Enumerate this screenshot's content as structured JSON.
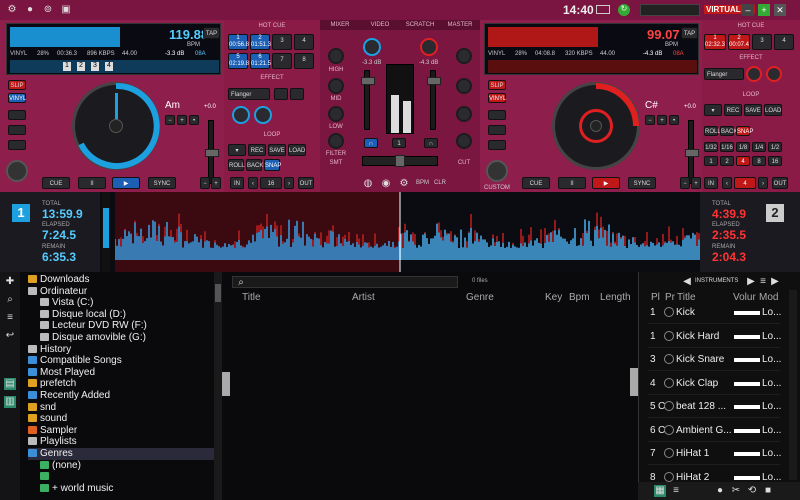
{
  "titlebar": {
    "time": "14:40",
    "battery_label": "",
    "brand": "VIRTUAL DJ"
  },
  "deck_left": {
    "bpm": "119.88",
    "bpm_unit": "BPM",
    "tap": "TAP",
    "pitch": "-3.3 dB",
    "key_display": "08A",
    "key": "Am",
    "pitch_val": "+0.0",
    "format": "VINYL",
    "pct": "28%",
    "time_a": "00:36.3",
    "bitrate": "896 KBPS",
    "sr": "44.00",
    "loop_val": "16",
    "flanger": "Flanger",
    "hotcue_nums": [
      "1",
      "2",
      "3",
      "4"
    ],
    "hotcue_times": [
      "00:56.8",
      "01:51.3",
      "",
      ""
    ],
    "hotcue_nums2": [
      "5",
      "6",
      "7",
      "8"
    ],
    "hotcue_times2": [
      "02:19.8",
      "01:21.5",
      "",
      ""
    ],
    "markers": [
      "1",
      "2",
      "3",
      "4"
    ]
  },
  "deck_right": {
    "bpm": "99.07",
    "bpm_unit": "BPM",
    "tap": "TAP",
    "pitch": "-4.3 dB",
    "key_display": "08A",
    "key": "C#",
    "pitch_val": "+0.0",
    "format": "VINYL",
    "pct": "28%",
    "time_a": "04:08.8",
    "bitrate": "320 KBPS",
    "sr": "44.00",
    "loop_val": "4",
    "flanger": "Flanger",
    "hotcue_nums": [
      "1",
      "2",
      "3",
      "4"
    ],
    "hotcue_times": [
      "02:32.3",
      "00:07.4",
      "",
      ""
    ]
  },
  "mixer": {
    "tabs": [
      "MIXER",
      "VIDEO",
      "SCRATCH",
      "MASTER"
    ],
    "labels": [
      "HIGH",
      "MID",
      "LOW",
      "FILTER",
      "GAIN",
      "GAIN",
      "SMT",
      "CUT"
    ],
    "gain_l": "-3.3 dB",
    "gain_r": "-4.3 dB",
    "cross_val": "1"
  },
  "deck_labels": {
    "hotcue": "HOT CUE",
    "effect": "EFFECT",
    "loop": "LOOP",
    "sync": "SYNC",
    "cue": "CUE",
    "play": "▶",
    "pause": "II",
    "slip": "SLIP",
    "vinyl": "VINYL",
    "custom": "CUSTOM",
    "in": "IN",
    "out": "OUT",
    "rec": "REC",
    "save": "SAVE",
    "load": "LOAD",
    "roll": "ROLL",
    "back": "BACK",
    "snap": "SNAP",
    "size_small": "1/32",
    "size_labels": [
      "1/16",
      "1/8",
      "1/4",
      "1/2",
      "1",
      "2",
      "4",
      "8",
      "16",
      "32"
    ]
  },
  "wave_left": {
    "deck": "1",
    "total_label": "TOTAL",
    "total": "13:59.9",
    "elapsed_label": "ELAPSED",
    "elapsed": "7:24.5",
    "remain_label": "REMAIN",
    "remain": "6:35.3"
  },
  "wave_right": {
    "deck": "2",
    "total_label": "TOTAL",
    "total": "4:39.9",
    "elapsed_label": "ELAPSED",
    "elapsed": "2:35.5",
    "remain_label": "REMAIN",
    "remain": "2:04.3"
  },
  "browser": {
    "tree": [
      {
        "label": "Downloads",
        "indent": 0,
        "color": "#e0a020"
      },
      {
        "label": "Ordinateur",
        "indent": 0,
        "color": "#bbbbbb"
      },
      {
        "label": "Vista (C:)",
        "indent": 1,
        "color": "#bbbbbb"
      },
      {
        "label": "Disque local (D:)",
        "indent": 1,
        "color": "#bbbbbb"
      },
      {
        "label": "Lecteur DVD RW (F:)",
        "indent": 1,
        "color": "#bbbbbb"
      },
      {
        "label": "Disque amovible (G:)",
        "indent": 1,
        "color": "#bbbbbb"
      },
      {
        "label": "History",
        "indent": 0,
        "color": "#bbbbbb"
      },
      {
        "label": "Compatible Songs",
        "indent": 0,
        "color": "#3a8fd8"
      },
      {
        "label": "Most Played",
        "indent": 0,
        "color": "#3a8fd8"
      },
      {
        "label": "prefetch",
        "indent": 0,
        "color": "#e0a020"
      },
      {
        "label": "Recently Added",
        "indent": 0,
        "color": "#3a8fd8"
      },
      {
        "label": "snd",
        "indent": 0,
        "color": "#e0a020"
      },
      {
        "label": "sound",
        "indent": 0,
        "color": "#e0a020"
      },
      {
        "label": "Sampler",
        "indent": 0,
        "color": "#e06020"
      },
      {
        "label": "Playlists",
        "indent": 0,
        "color": "#bbbbbb"
      },
      {
        "label": "Genres",
        "indent": 0,
        "color": "#3a8fd8"
      },
      {
        "label": "(none)",
        "indent": 1,
        "color": "#3ab060"
      },
      {
        "label": "",
        "indent": 1,
        "color": "#3ab060"
      },
      {
        "label": "+ world music",
        "indent": 1,
        "color": "#3ab060"
      }
    ],
    "search_placeholder": "",
    "files_count": "0 files",
    "columns": [
      "Title",
      "Artist",
      "Genre",
      "Key",
      "Bpm",
      "Length"
    ],
    "sidebar_tabs": [
      "sideview",
      "sideview"
    ],
    "sampler_header": "INSTRUMENTS",
    "sampler_cols": [
      "Pl",
      "Pr",
      "Title",
      "Volur",
      "Mod"
    ],
    "samples": [
      {
        "n": "1",
        "pr": "",
        "t": "Kick",
        "m": "Lo..."
      },
      {
        "n": "1",
        "pr": "",
        "t": "Kick Hard",
        "m": "Lo..."
      },
      {
        "n": "3",
        "pr": "",
        "t": "Kick Snare",
        "m": "Lo..."
      },
      {
        "n": "4",
        "pr": "",
        "t": "Kick Clap",
        "m": "Lo..."
      },
      {
        "n": "5",
        "pr": "C",
        "t": "beat 128 ...",
        "m": "Lo..."
      },
      {
        "n": "6",
        "pr": "C",
        "t": "Ambient G...",
        "m": "Lo..."
      },
      {
        "n": "7",
        "pr": "",
        "t": "HiHat 1",
        "m": "Lo..."
      },
      {
        "n": "8",
        "pr": "",
        "t": "HiHat 2",
        "m": "Lo..."
      }
    ]
  },
  "colors": {
    "accent": "#8a1c48",
    "blue": "#1da0e0",
    "red": "#e02020"
  }
}
